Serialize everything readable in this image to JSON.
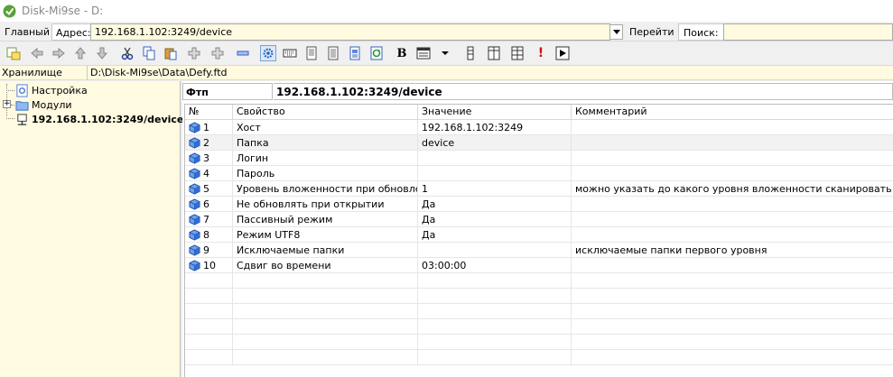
{
  "window": {
    "title": "Disk-Mi9se - D:"
  },
  "address_bar": {
    "main_tab": "Главный",
    "address_label": "Адрес:",
    "address_value": "192.168.1.102:3249/device",
    "go_button": "Перейти",
    "search_label": "Поиск:",
    "search_value": ""
  },
  "toolbar": {
    "icons": [
      "add-icon",
      "back-arrow-icon",
      "forward-arrow-icon",
      "up-arrow-icon",
      "down-arrow-icon",
      "cut-icon",
      "copy-icon",
      "paste-icon",
      "add-node-icon",
      "add-child-icon",
      "minus-icon",
      "settings-icon",
      "keyboard-icon",
      "document-icon",
      "document-copy-icon",
      "document-blue-icon",
      "refresh-icon",
      "bold-icon",
      "list-view-icon",
      "dropdown-arrow-icon",
      "column-icon",
      "split-icon",
      "grid-icon",
      "exclamation-icon",
      "play-icon"
    ],
    "bold_glyph": "B",
    "exclamation_glyph": "!"
  },
  "path_row": {
    "storage_label": "Хранилище",
    "path_value": "D:\\Disk-Mi9se\\Data\\Defy.ftd"
  },
  "tree": {
    "items": [
      {
        "label": "Настройка",
        "icon": "settings-tree-icon"
      },
      {
        "label": "Модули",
        "icon": "folder-icon"
      },
      {
        "label": "192.168.1.102:3249/device",
        "icon": "ftp-icon",
        "selected": true
      }
    ]
  },
  "panel": {
    "type_label": "Фтп",
    "path_label": "192.168.1.102:3249/device"
  },
  "grid": {
    "columns": [
      "№",
      "Свойство",
      "Значение",
      "Комментарий"
    ],
    "rows": [
      {
        "num": "1",
        "property": "Хост",
        "value": "192.168.1.102:3249",
        "comment": ""
      },
      {
        "num": "2",
        "property": "Папка",
        "value": "device",
        "comment": ""
      },
      {
        "num": "3",
        "property": "Логин",
        "value": "",
        "comment": ""
      },
      {
        "num": "4",
        "property": "Пароль",
        "value": "",
        "comment": ""
      },
      {
        "num": "5",
        "property": "Уровень вложенности при обновле...",
        "value": "1",
        "comment": "можно указать до какого уровня вложенности сканировать данные,"
      },
      {
        "num": "6",
        "property": "Не обновлять при открытии",
        "value": "Да",
        "comment": ""
      },
      {
        "num": "7",
        "property": "Пассивный режим",
        "value": "Да",
        "comment": ""
      },
      {
        "num": "8",
        "property": "Режим UTF8",
        "value": "Да",
        "comment": ""
      },
      {
        "num": "9",
        "property": "Исключаемые папки",
        "value": "",
        "comment": "исключаемые папки первого уровня"
      },
      {
        "num": "10",
        "property": "Сдвиг во времени",
        "value": "03:00:00",
        "comment": ""
      }
    ]
  },
  "colors": {
    "accent_yellow": "#fffae0",
    "selection_gray": "#f2f2f2",
    "cube_blue": "#2b6fd6"
  }
}
